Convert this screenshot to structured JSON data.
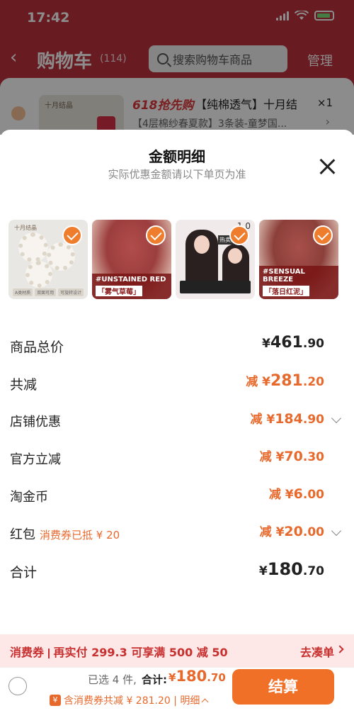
{
  "status_bar": {
    "time": "17:42"
  },
  "header": {
    "title": "购物车",
    "count": "(114)",
    "search_placeholder": "搜索购物车商品",
    "manage": "管理"
  },
  "cart_item": {
    "tag": "618抢先购",
    "title": "【纯棉透气】十月结",
    "qty": "×1",
    "subtitle": "【4层棉纱春夏款】3条装-童梦国...",
    "thumb_brand": "十月结晶"
  },
  "sheet": {
    "title": "金额明细",
    "subtitle": "实际优惠金额请以下单页为准",
    "thumbs": [
      {
        "brand": "十月结晶",
        "tags": [
          "A类材质",
          "双面可用",
          "可旋转设计"
        ]
      },
      {
        "en": "#UNSTAINED RED",
        "cn": "「雾气草莓」"
      },
      {
        "num": "1.0",
        "badge": "热卖爆款"
      },
      {
        "en": "#SENSUAL BREEZE",
        "cn": "「落日红泥」"
      }
    ],
    "rows": [
      {
        "label": "商品总价",
        "prefix": "¥",
        "int": "461",
        "dec": ".90"
      },
      {
        "label": "共减",
        "prefix": "减 ¥",
        "int": "281",
        "dec": ".20"
      },
      {
        "label": "店铺优惠",
        "prefix": "减 ¥",
        "int": "184",
        "dec": ".90"
      },
      {
        "label": "官方立减",
        "prefix": "减 ¥",
        "int": "70",
        "dec": ".30"
      },
      {
        "label": "淘金币",
        "prefix": "减 ¥",
        "int": "6",
        "dec": ".00"
      },
      {
        "label": "红包",
        "note": "消费券已抵 ¥ 20",
        "prefix": "减 ¥",
        "int": "20",
        "dec": ".00"
      },
      {
        "label": "合计",
        "prefix": "¥",
        "int": "180",
        "dec": ".70"
      }
    ]
  },
  "coupon_bar": {
    "label": "消费券",
    "text": "再实付 299.3 可享满 500 减 50",
    "link": "去凑单"
  },
  "bottom_bar": {
    "selected": "已选 4 件,",
    "total_label": "合计:",
    "total_prefix": "¥",
    "total_int": "180",
    "total_dec": ".70",
    "discount": "含消费券共减 ¥ 281.20 | 明细",
    "pay": "结算"
  },
  "colors": {
    "accent": "#e8692c",
    "header": "#c0323f",
    "coupon": "#c8302f"
  }
}
